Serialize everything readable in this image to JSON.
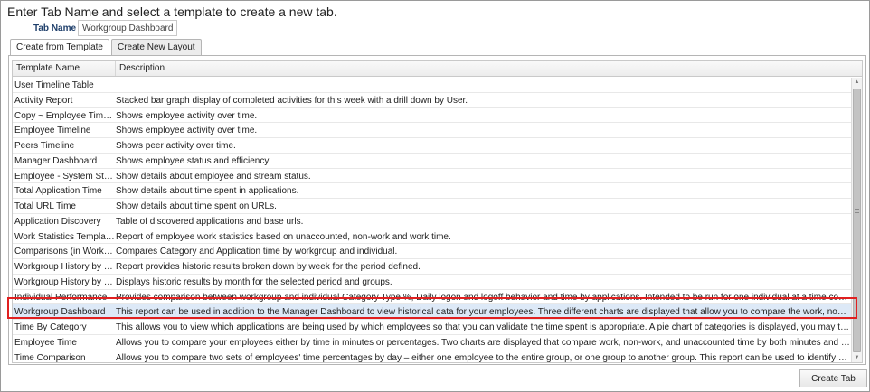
{
  "heading": "Enter Tab Name and select a template to create a new tab.",
  "tab_name": {
    "label": "Tab Name :",
    "value": "Workgroup Dashboard"
  },
  "tabs": [
    {
      "label": "Create from Template",
      "active": true
    },
    {
      "label": "Create New Layout",
      "active": false
    }
  ],
  "grid": {
    "columns": [
      "Template Name",
      "Description"
    ],
    "rows": [
      {
        "name": "User Timeline Table",
        "description": ""
      },
      {
        "name": "Activity Report",
        "description": "Stacked bar graph display of completed activities for this week with a drill down by User."
      },
      {
        "name": "Copy ~ Employee Timeline",
        "description": "Shows employee activity over time."
      },
      {
        "name": "Employee Timeline",
        "description": "Shows employee activity over time."
      },
      {
        "name": "Peers Timeline",
        "description": "Shows peer activity over time."
      },
      {
        "name": "Manager Dashboard",
        "description": "Shows employee status and efficiency"
      },
      {
        "name": "Employee - System Status",
        "description": "Show details about employee and stream status."
      },
      {
        "name": "Total Application Time",
        "description": "Show details about time spent in applications."
      },
      {
        "name": "Total URL Time",
        "description": "Show details about time spent on URLs."
      },
      {
        "name": "Application Discovery",
        "description": "Table of discovered applications and base urls."
      },
      {
        "name": "Work Statistics Template (P...",
        "description": "Report of employee work statistics based on unaccounted, non-work and work time."
      },
      {
        "name": "Comparisons (in Workgroup)",
        "description": "Compares Category and Application time by workgroup and individual."
      },
      {
        "name": "Workgroup History by Week",
        "description": "Report provides historic results broken down by week for the period defined."
      },
      {
        "name": "Workgroup History by Month",
        "description": "Displays historic results by month for the selected period and groups."
      },
      {
        "name": "Individual Performance",
        "description": "Provides comparison between workgroup and individual Category Type %, Daily logon and logoff behavior and time by applications. Intended to be run for one individual at a time compared to the workgroup totals for th..."
      },
      {
        "name": "Workgroup Dashboard",
        "description": "This report can be used in addition to the Manager Dashboard to view historical data for your employees. Three different charts are displayed that allow you to compare the work, non-work and unaccounted time for a gr...",
        "selected": true
      },
      {
        "name": "Time By Category",
        "description": "This allows you to view which applications are being used by which employees so that you can validate the time spent is appropriate. A pie chart of categories is displayed, you may then drill down into applications in tha..."
      },
      {
        "name": "Employee Time",
        "description": "Allows you to compare your employees either by time in minutes or percentages. Two charts are displayed that compare work, non-work, and unaccounted time by both minutes and percentages. Drilldowns are availabl..."
      },
      {
        "name": "Time Comparison",
        "description": "Allows you to compare two sets of employees' time percentages by day – either one employee to the entire group, or one group to another group. This report can be used to identify patterns (i.e. high productive days in t..."
      }
    ]
  },
  "create_button": "Create Tab",
  "colors": {
    "selection_bg": "#dde9f7",
    "highlight_border": "#e02020",
    "label_blue": "#1f3f6b"
  }
}
